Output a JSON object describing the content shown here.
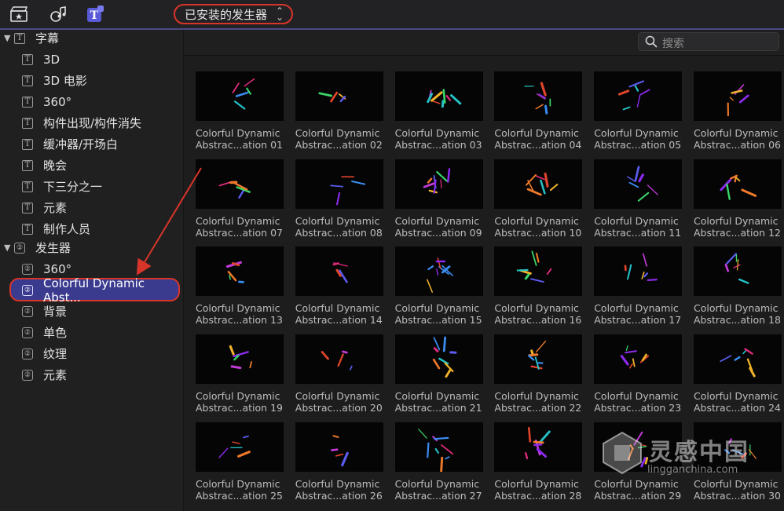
{
  "toolbar": {
    "icons": [
      "clapperboard-star-icon",
      "music-photo-icon",
      "titles-generators-icon"
    ],
    "dropdown_label": "已安装的发生器",
    "accent": "#4b4a86",
    "highlight": "#d8352a"
  },
  "sidebar": {
    "sections": [
      {
        "label": "字幕",
        "expanded": true,
        "icon": "T"
      },
      {
        "label": "发生器",
        "expanded": true,
        "icon": "gen"
      }
    ],
    "title_items": [
      "3D",
      "3D 电影",
      "360°",
      "构件出现/构件消失",
      "缓冲器/开场白",
      "晚会",
      "下三分之一",
      "元素",
      "制作人员"
    ],
    "generator_items": [
      "360°",
      "Colorful Dynamic Abst...",
      "背景",
      "单色",
      "纹理",
      "元素"
    ],
    "selected_item": "Colorful Dynamic Abst...",
    "selected_color": "#3a3b8f"
  },
  "search": {
    "placeholder": "搜索"
  },
  "grid": {
    "items": [
      {
        "line1": "Colorful Dynamic",
        "line2": "Abstrac...ation 01"
      },
      {
        "line1": "Colorful Dynamic",
        "line2": "Abstrac...ation 02"
      },
      {
        "line1": "Colorful Dynamic",
        "line2": "Abstrac...ation 03"
      },
      {
        "line1": "Colorful Dynamic",
        "line2": "Abstrac...ation 04"
      },
      {
        "line1": "Colorful Dynamic",
        "line2": "Abstrac...ation 05"
      },
      {
        "line1": "Colorful Dynamic",
        "line2": "Abstrac...ation 06"
      },
      {
        "line1": "Colorful Dynamic",
        "line2": "Abstrac...ation 07"
      },
      {
        "line1": "Colorful Dynamic",
        "line2": "Abstrac...ation 08"
      },
      {
        "line1": "Colorful Dynamic",
        "line2": "Abstrac...ation 09"
      },
      {
        "line1": "Colorful Dynamic",
        "line2": "Abstrac...ation 10"
      },
      {
        "line1": "Colorful Dynamic",
        "line2": "Abstrac...ation 11"
      },
      {
        "line1": "Colorful Dynamic",
        "line2": "Abstrac...ation 12"
      },
      {
        "line1": "Colorful Dynamic",
        "line2": "Abstrac...ation 13"
      },
      {
        "line1": "Colorful Dynamic",
        "line2": "Abstrac...ation 14"
      },
      {
        "line1": "Colorful Dynamic",
        "line2": "Abstrac...ation 15"
      },
      {
        "line1": "Colorful Dynamic",
        "line2": "Abstrac...ation 16"
      },
      {
        "line1": "Colorful Dynamic",
        "line2": "Abstrac...ation 17"
      },
      {
        "line1": "Colorful Dynamic",
        "line2": "Abstrac...ation 18"
      },
      {
        "line1": "Colorful Dynamic",
        "line2": "Abstrac...ation 19"
      },
      {
        "line1": "Colorful Dynamic",
        "line2": "Abstrac...ation 20"
      },
      {
        "line1": "Colorful Dynamic",
        "line2": "Abstrac...ation 21"
      },
      {
        "line1": "Colorful Dynamic",
        "line2": "Abstrac...ation 22"
      },
      {
        "line1": "Colorful Dynamic",
        "line2": "Abstrac...ation 23"
      },
      {
        "line1": "Colorful Dynamic",
        "line2": "Abstrac...ation 24"
      },
      {
        "line1": "Colorful Dynamic",
        "line2": "Abstrac...ation 25"
      },
      {
        "line1": "Colorful Dynamic",
        "line2": "Abstrac...ation 26"
      },
      {
        "line1": "Colorful Dynamic",
        "line2": "Abstrac...ation 27"
      },
      {
        "line1": "Colorful Dynamic",
        "line2": "Abstrac...ation 28"
      },
      {
        "line1": "Colorful Dynamic",
        "line2": "Abstrac...ation 29"
      },
      {
        "line1": "Colorful Dynamic",
        "line2": "Abstrac...ation 30"
      }
    ]
  },
  "watermark": {
    "title": "灵感中国",
    "url": "lingganchina.com"
  }
}
